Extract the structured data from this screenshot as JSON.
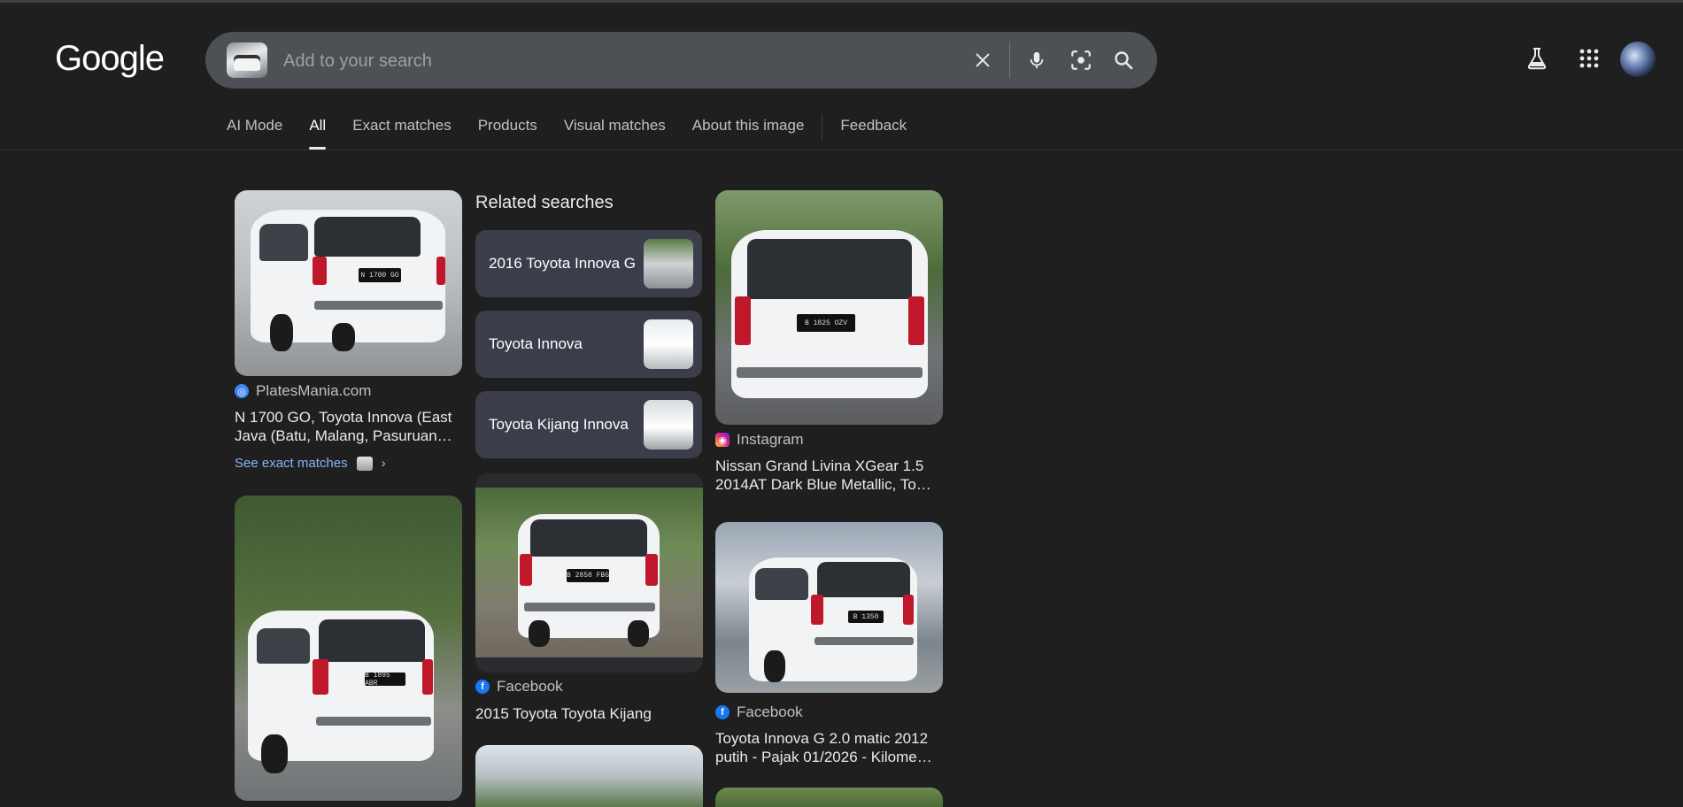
{
  "header": {
    "logo": "Google",
    "search_placeholder": "Add to your search"
  },
  "tabs": [
    {
      "label": "AI Mode"
    },
    {
      "label": "All"
    },
    {
      "label": "Exact matches"
    },
    {
      "label": "Products"
    },
    {
      "label": "Visual matches"
    },
    {
      "label": "About this image"
    },
    {
      "label": "Feedback"
    }
  ],
  "results": {
    "col1": [
      {
        "source": "PlatesMania.com",
        "title_line1": "N 1700 GO, Toyota Innova (East",
        "title_line2": "Java (Batu, Malang, Pasuruan…",
        "plate": "N 1700 GO",
        "see_exact": "See exact matches"
      },
      {
        "plate": "B 1895 ABR"
      }
    ],
    "related": {
      "heading": "Related searches",
      "items": [
        {
          "label": "2016 Toyota Innova G"
        },
        {
          "label": "Toyota Innova"
        },
        {
          "label": "Toyota Kijang Innova"
        }
      ]
    },
    "col2": [
      {
        "source": "Facebook",
        "title_line1": "2015 Toyota Toyota Kijang",
        "plate": "B 2858 FBG"
      }
    ],
    "col3": [
      {
        "source": "Instagram",
        "title_line1": "Nissan Grand Livina XGear 1.5",
        "title_line2": "2014AT Dark Blue Metallic, To…",
        "plate": "B 1825 OZV"
      },
      {
        "source": "Facebook",
        "title_line1": "Toyota Innova G 2.0 matic 2012",
        "title_line2": "putih - Pajak 01/2026 - Kilome…",
        "plate": "B 1350"
      }
    ]
  },
  "colors": {
    "background": "#1f1f1f",
    "searchbar": "#4d5156",
    "related_chip": "#3b3e4a",
    "link": "#8ab4f8",
    "facebook": "#1877f2",
    "instagram": "#e1306c"
  }
}
